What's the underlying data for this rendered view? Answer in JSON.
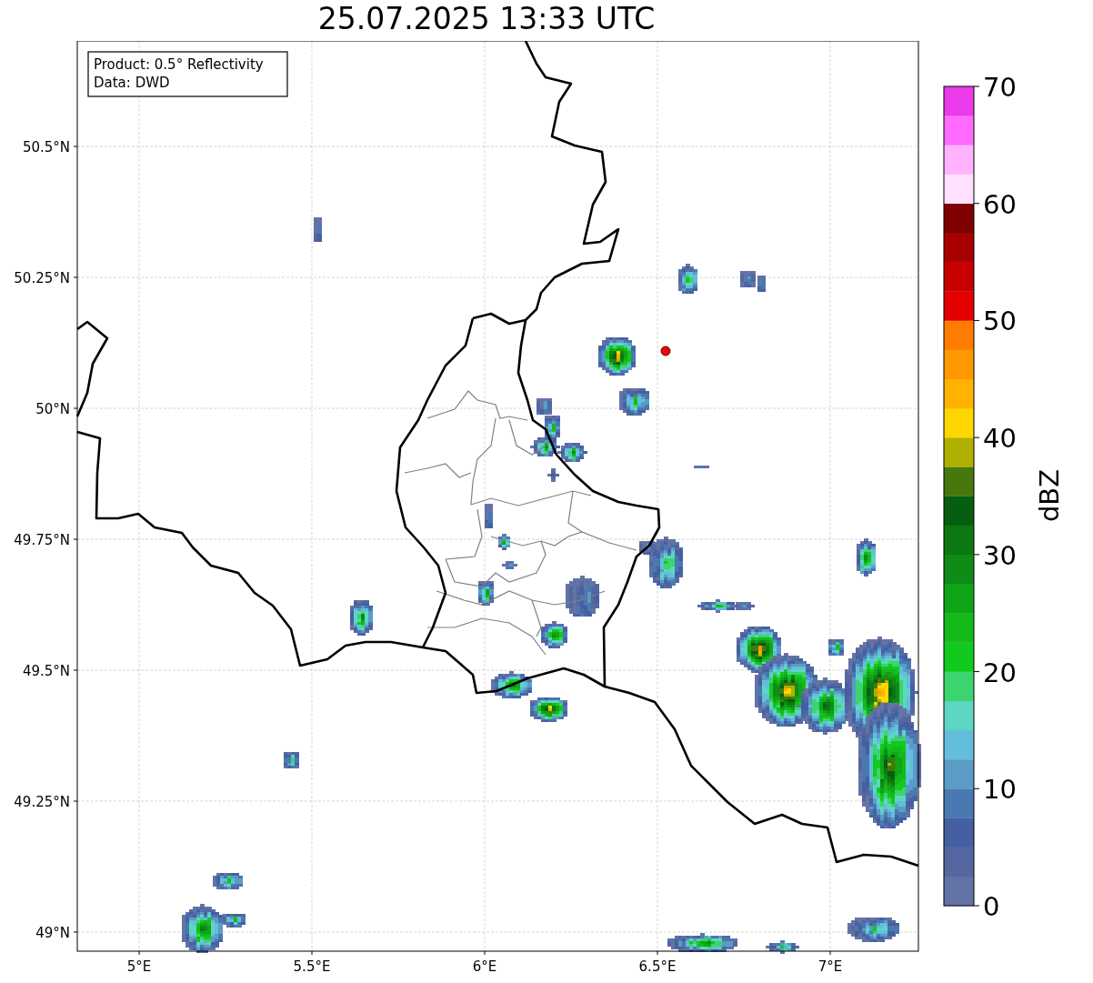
{
  "title": "25.07.2025 13:33 UTC",
  "legend": [
    "Product: 0.5° Reflectivity",
    "Data: DWD"
  ],
  "x_ticks": [
    {
      "label": "5°E"
    },
    {
      "label": "5.5°E"
    },
    {
      "label": "6°E"
    },
    {
      "label": "6.5°E"
    },
    {
      "label": "7°E"
    }
  ],
  "y_ticks": [
    {
      "label": "50.5°N"
    },
    {
      "label": "50.25°N"
    },
    {
      "label": "50°N"
    },
    {
      "label": "49.75°N"
    },
    {
      "label": "49.5°N"
    },
    {
      "label": "49.25°N"
    },
    {
      "label": "49°N"
    }
  ],
  "colorbar": {
    "label": "dBZ",
    "ticks": [
      "70",
      "60",
      "50",
      "40",
      "30",
      "20",
      "10",
      "0"
    ],
    "bins": [
      {
        "color": "#6473a6"
      },
      {
        "color": "#5467a0"
      },
      {
        "color": "#4560a2"
      },
      {
        "color": "#4a78b0"
      },
      {
        "color": "#5a9cc6"
      },
      {
        "color": "#63bedc"
      },
      {
        "color": "#5dd6c2"
      },
      {
        "color": "#3cd46e"
      },
      {
        "color": "#12c91e"
      },
      {
        "color": "#14b91a"
      },
      {
        "color": "#10a516"
      },
      {
        "color": "#0f8b17"
      },
      {
        "color": "#0c7812"
      },
      {
        "color": "#065e10"
      },
      {
        "color": "#46780e"
      },
      {
        "color": "#b0b000"
      },
      {
        "color": "#ffd700"
      },
      {
        "color": "#ffb300"
      },
      {
        "color": "#ff9900"
      },
      {
        "color": "#ff7c00"
      },
      {
        "color": "#e40000"
      },
      {
        "color": "#c80000"
      },
      {
        "color": "#a80000"
      },
      {
        "color": "#7e0000"
      },
      {
        "color": "#ffe0ff"
      },
      {
        "color": "#ffb3ff"
      },
      {
        "color": "#ff6bff"
      },
      {
        "color": "#ea3aea"
      }
    ]
  }
}
